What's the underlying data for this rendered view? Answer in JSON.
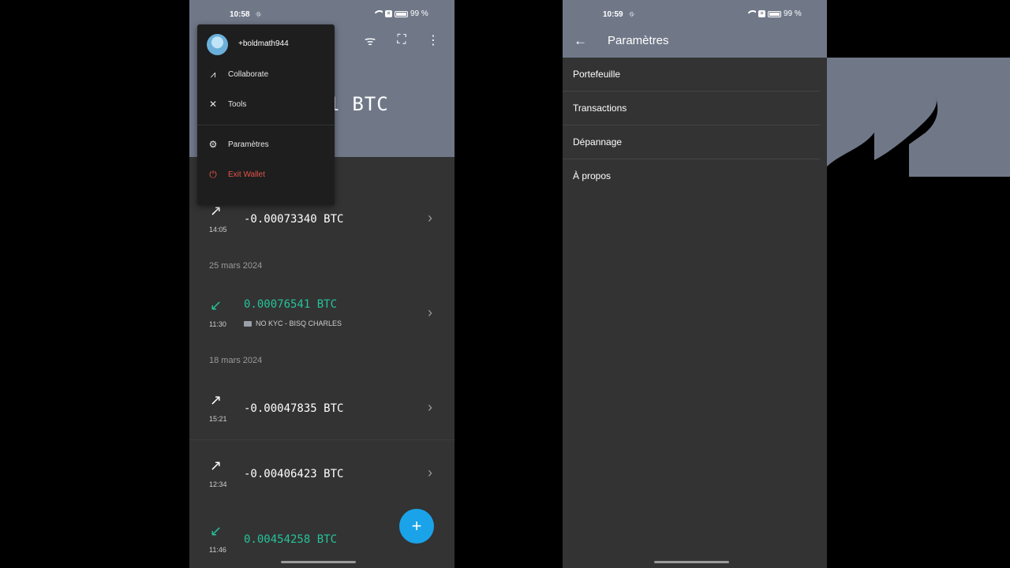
{
  "left_screen": {
    "status": {
      "time": "10:58",
      "battery": "99 %"
    },
    "balance": "91 BTC",
    "menu": {
      "username": "+boldmath944",
      "items": [
        {
          "label": "Collaborate",
          "icon": "collaborate-icon"
        },
        {
          "label": "Tools",
          "icon": "tools-icon"
        },
        {
          "label": "Paramètres",
          "icon": "gear-icon"
        },
        {
          "label": "Exit Wallet",
          "icon": "power-icon"
        }
      ]
    },
    "transactions": [
      {
        "time": "14:05",
        "amount": "-0.00073340 BTC",
        "direction": "out"
      },
      {
        "date_header": "25 mars 2024"
      },
      {
        "time": "11:30",
        "amount": "0.00076541 BTC",
        "direction": "in",
        "label": "NO KYC - BISQ CHARLES"
      },
      {
        "date_header": "18 mars 2024"
      },
      {
        "time": "15:21",
        "amount": "-0.00047835 BTC",
        "direction": "out"
      },
      {
        "time": "12:34",
        "amount": "-0.00406423 BTC",
        "direction": "out"
      },
      {
        "time": "11:46",
        "amount": "0.00454258 BTC",
        "direction": "in"
      }
    ],
    "fab_label": "+"
  },
  "right_screen": {
    "status": {
      "time": "10:59",
      "battery": "99 %"
    },
    "title": "Paramètres",
    "items": [
      "Portefeuille",
      "Transactions",
      "Dépannage",
      "À propos"
    ]
  },
  "colors": {
    "background": "#707888",
    "panel": "#333333",
    "incoming": "#25c39a",
    "danger": "#e5534b",
    "fab": "#1aa3e8"
  }
}
